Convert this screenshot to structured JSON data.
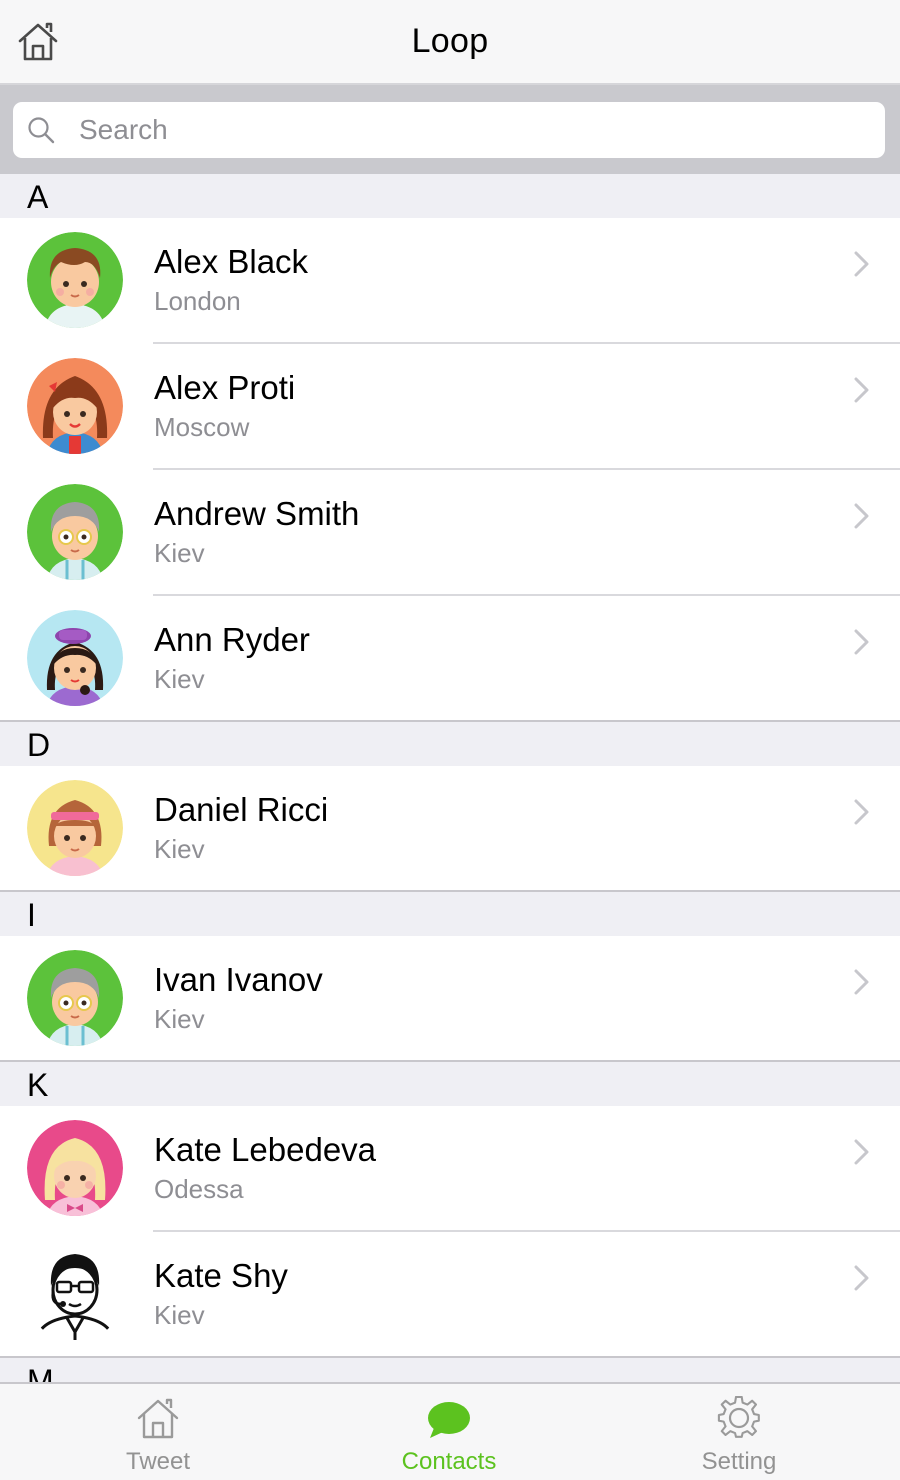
{
  "navbar": {
    "title": "Loop",
    "home_icon": "home-icon"
  },
  "search": {
    "placeholder": "Search",
    "value": "",
    "icon": "search-icon"
  },
  "sections": [
    {
      "letter": "A",
      "contacts": [
        {
          "name": "Alex Black",
          "city": "London"
        },
        {
          "name": "Alex Proti",
          "city": "Moscow"
        },
        {
          "name": "Andrew Smith",
          "city": "Kiev"
        },
        {
          "name": "Ann Ryder",
          "city": "Kiev"
        }
      ]
    },
    {
      "letter": "D",
      "contacts": [
        {
          "name": "Daniel Ricci",
          "city": "Kiev"
        }
      ]
    },
    {
      "letter": "I",
      "contacts": [
        {
          "name": "Ivan Ivanov",
          "city": "Kiev"
        }
      ]
    },
    {
      "letter": "K",
      "contacts": [
        {
          "name": "Kate Lebedeva",
          "city": "Odessa"
        },
        {
          "name": "Kate Shy",
          "city": "Kiev"
        }
      ]
    },
    {
      "letter": "M",
      "contacts": []
    }
  ],
  "tabbar": {
    "tabs": [
      {
        "label": "Tweet",
        "icon": "home-icon",
        "active": false
      },
      {
        "label": "Contacts",
        "icon": "chat-bubble-icon",
        "active": true
      },
      {
        "label": "Setting",
        "icon": "gear-icon",
        "active": false
      }
    ]
  },
  "colors": {
    "accent": "#5cc21f",
    "secondary_text": "#8e8e93",
    "section_bg": "#efeff4",
    "search_bar_bg": "#c9c9ce"
  }
}
